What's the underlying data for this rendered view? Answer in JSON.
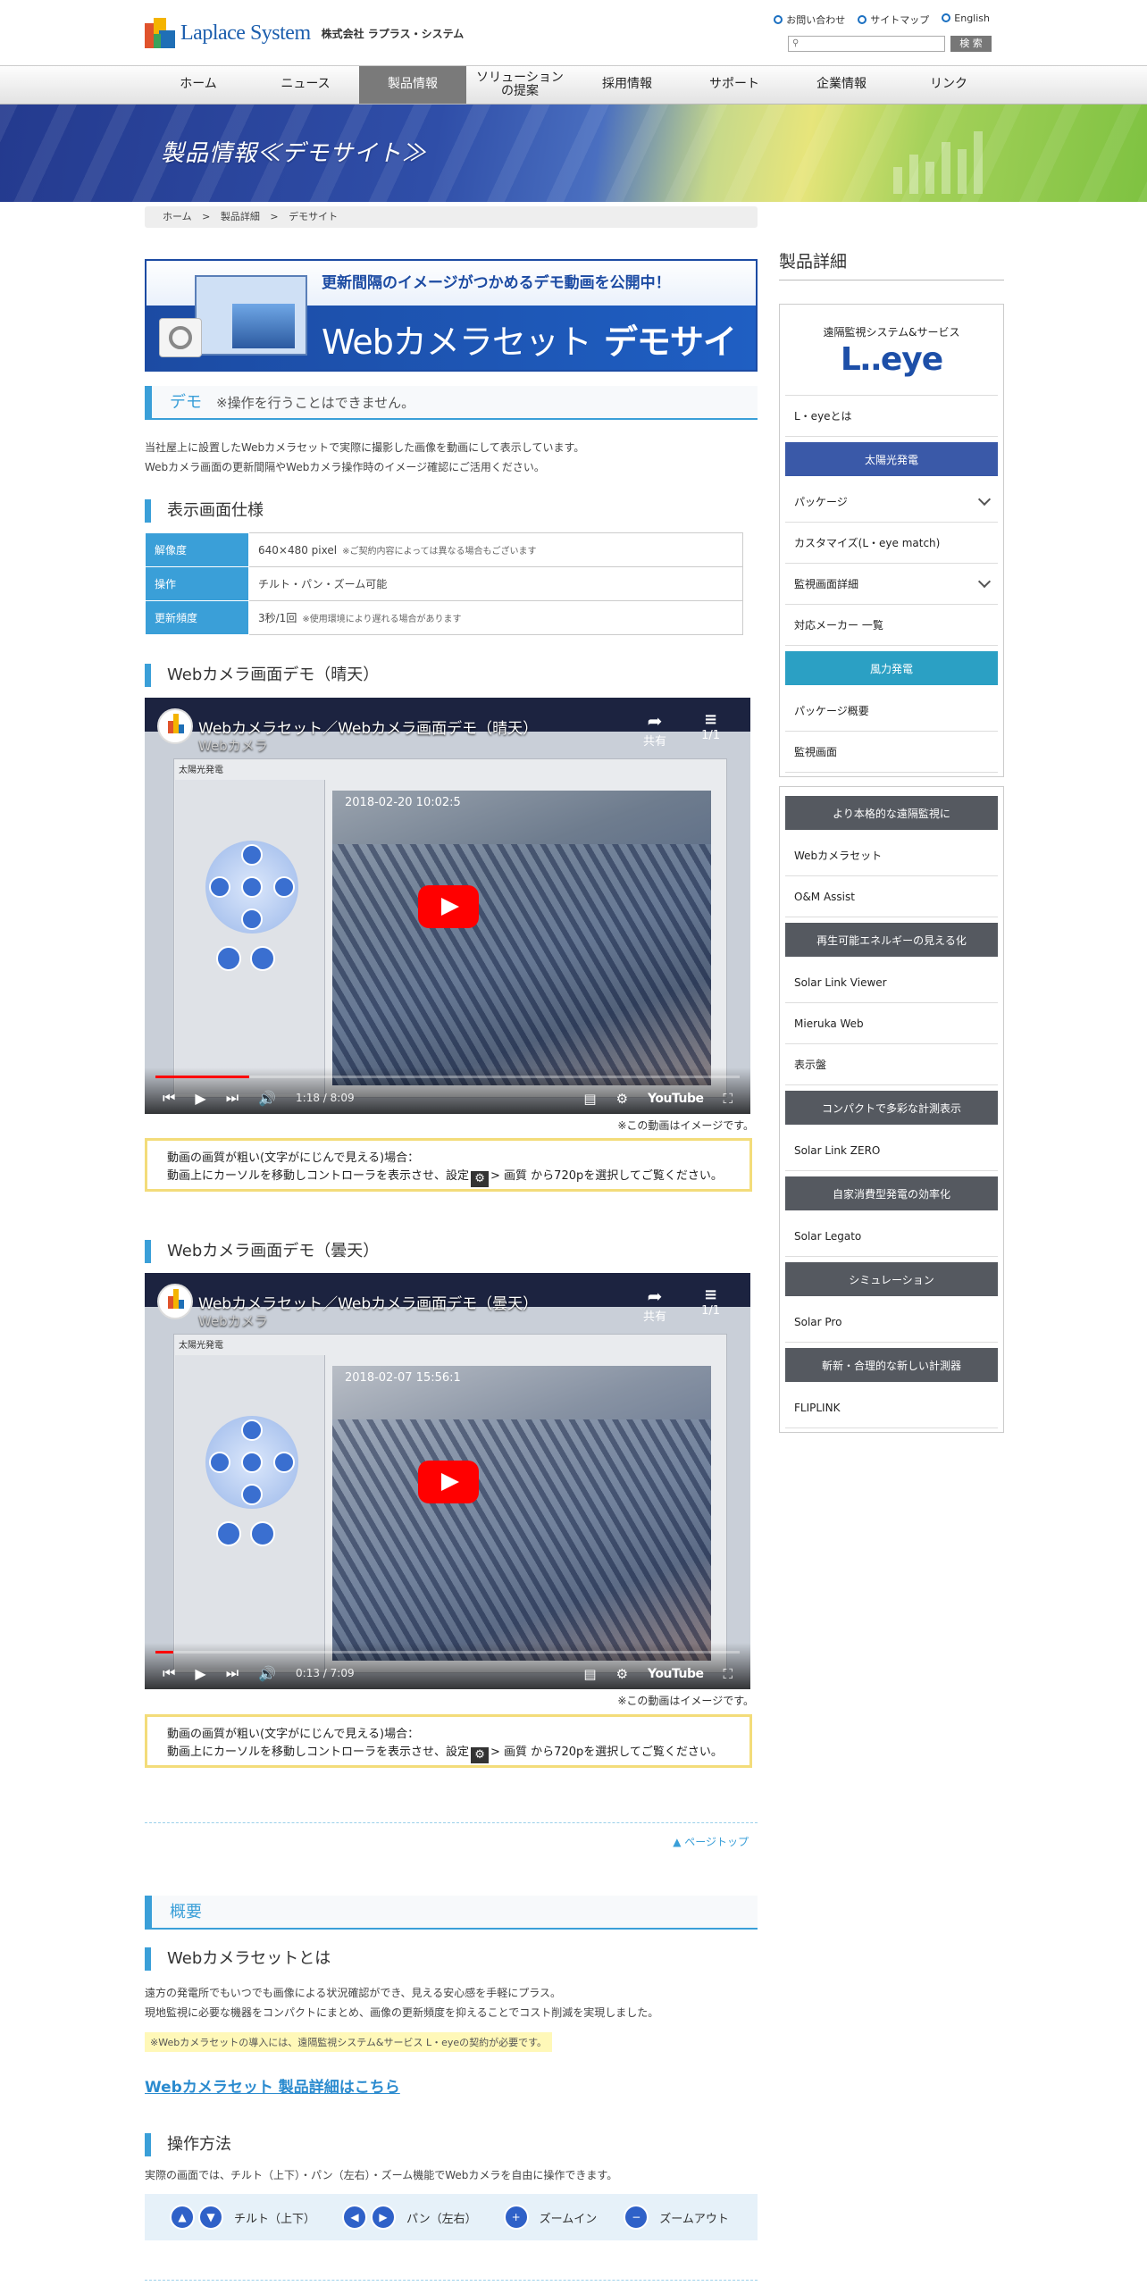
{
  "header": {
    "logo_text": "Laplace System",
    "logo_sub": "株式会社 ラプラス・システム",
    "util_links": [
      "お問い合わせ",
      "サイトマップ",
      "English"
    ],
    "search_button": "検 索"
  },
  "nav": {
    "items": [
      "ホーム",
      "ニュース",
      "製品情報",
      "ソリューション\nの提案",
      "採用情報",
      "サポート",
      "企業情報",
      "リンク"
    ],
    "active": "製品情報"
  },
  "banner": {
    "title": "製品情報≪デモサイト≫"
  },
  "breadcrumb": [
    "ホーム",
    ">",
    "製品詳細",
    ">",
    "デモサイト"
  ],
  "demo_banner": {
    "tagline": "更新間隔のイメージがつかめるデモ動画を公開中！",
    "title_a": "Webカメラセット",
    "title_b": "デモサイト"
  },
  "demo_section": {
    "heading": "デモ",
    "heading_note": "※操作を行うことはできません。",
    "intro_1": "当社屋上に設置したWebカメラセットで実際に撮影した画像を動画にして表示しています。",
    "intro_2": "Webカメラ画面の更新間隔やWebカメラ操作時のイメージ確認にご活用ください。"
  },
  "spec": {
    "heading": "表示画面仕様",
    "rows": [
      {
        "key": "解像度",
        "value": "640×480 pixel",
        "note": "※ご契約内容によっては異なる場合もございます"
      },
      {
        "key": "操作",
        "value": "チルト・パン・ズーム可能",
        "note": ""
      },
      {
        "key": "更新頻度",
        "value": "3秒/1回",
        "note": "※使用環境により遅れる場合があります"
      }
    ]
  },
  "videos": [
    {
      "heading": "Webカメラ画面デモ（晴天）",
      "yt_title": "Webカメラセット／Webカメラ画面デモ（晴天）",
      "yt_channel": "Webカメラ",
      "stamp": "2018-02-20 10:02:5",
      "time": "1:18 / 8:09",
      "progress": 0.16,
      "share": "共有",
      "playlist": "1/1",
      "panel_title": "太陽光発電",
      "yt_logo": "YouTube",
      "caption": "※この動画はイメージです。",
      "note_1": "動画の画質が粗い(文字がにじんで見える)場合：",
      "note_2a": "動画上にカーソルを移動しコントローラを表示させ、設定",
      "note_2b": "> 画質 から720pを選択してご覧ください。"
    },
    {
      "heading": "Webカメラ画面デモ（曇天）",
      "yt_title": "Webカメラセット／Webカメラ画面デモ（曇天）",
      "yt_channel": "Webカメラ",
      "stamp": "2018-02-07 15:56:1",
      "time": "0:13 / 7:09",
      "progress": 0.03,
      "share": "共有",
      "playlist": "1/1",
      "panel_title": "太陽光発電",
      "yt_logo": "YouTube",
      "caption": "※この動画はイメージです。",
      "note_1": "動画の画質が粗い(文字がにじんで見える)場合：",
      "note_2a": "動画上にカーソルを移動しコントローラを表示させ、設定",
      "note_2b": "> 画質 から720pを選択してご覧ください。"
    }
  ],
  "pagetop": "ページトップ",
  "overview": {
    "heading": "概要",
    "sub_heading": "Webカメラセットとは",
    "text_1": "遠方の発電所でもいつでも画像による状況確認ができ、見える安心感を手軽にプラス。",
    "text_2": "現地監視に必要な機器をコンパクトにまとめ、画像の更新頻度を抑えることでコスト削減を実現しました。",
    "highlight": "※Webカメラセットの導入には、遠隔監視システム&サービス L・eyeの契約が必要です。",
    "link": "Webカメラセット 製品詳細はこちら"
  },
  "operation": {
    "heading": "操作方法",
    "text": "実際の画面では、チルト（上下）・パン（左右）・ズーム機能でWebカメラを自由に操作できます。",
    "items": [
      "チルト（上下）",
      "パン（左右）",
      "ズームイン",
      "ズームアウト"
    ]
  },
  "sidebar": {
    "title": "製品詳細",
    "leye_sub": "遠隔監視システム&サービス",
    "leye_logo": "L‥eye",
    "box1": [
      {
        "type": "row",
        "label": "L・eyeとは"
      },
      {
        "type": "cat",
        "label": "太陽光発電",
        "color": "#3a59a8"
      },
      {
        "type": "row",
        "label": "パッケージ",
        "chevron": true
      },
      {
        "type": "row",
        "label": "カスタマイズ(L・eye match)"
      },
      {
        "type": "row",
        "label": "監視画面詳細",
        "chevron": true
      },
      {
        "type": "row",
        "label": "対応メーカー 一覧"
      },
      {
        "type": "cat",
        "label": "風力発電",
        "color": "#2ba0c4"
      },
      {
        "type": "row",
        "label": "パッケージ概要"
      },
      {
        "type": "row",
        "label": "監視画面"
      }
    ],
    "box2": [
      {
        "type": "cat",
        "label": "より本格的な遠隔監視に"
      },
      {
        "type": "row",
        "label": "Webカメラセット"
      },
      {
        "type": "row",
        "label": "O&M Assist"
      },
      {
        "type": "cat",
        "label": "再生可能エネルギーの見える化"
      },
      {
        "type": "row",
        "label": "Solar Link Viewer"
      },
      {
        "type": "row",
        "label": "Mieruka Web"
      },
      {
        "type": "row",
        "label": "表示盤"
      },
      {
        "type": "cat",
        "label": "コンパクトで多彩な計測表示"
      },
      {
        "type": "row",
        "label": "Solar Link ZERO"
      },
      {
        "type": "cat",
        "label": "自家消費型発電の効率化"
      },
      {
        "type": "row",
        "label": "Solar Legato"
      },
      {
        "type": "cat",
        "label": "シミュレーション"
      },
      {
        "type": "row",
        "label": "Solar Pro"
      },
      {
        "type": "cat",
        "label": "斬新・合理的な新しい計測器"
      },
      {
        "type": "row",
        "label": "FLIPLINK"
      }
    ]
  },
  "colors": {
    "accent": "#3a9fd8",
    "nav_active": "#7a7a7a",
    "category_blue": "#3a59a8",
    "category_teal": "#2ba0c4",
    "category_gray": "#555960",
    "note_border": "#f3dc7a"
  }
}
